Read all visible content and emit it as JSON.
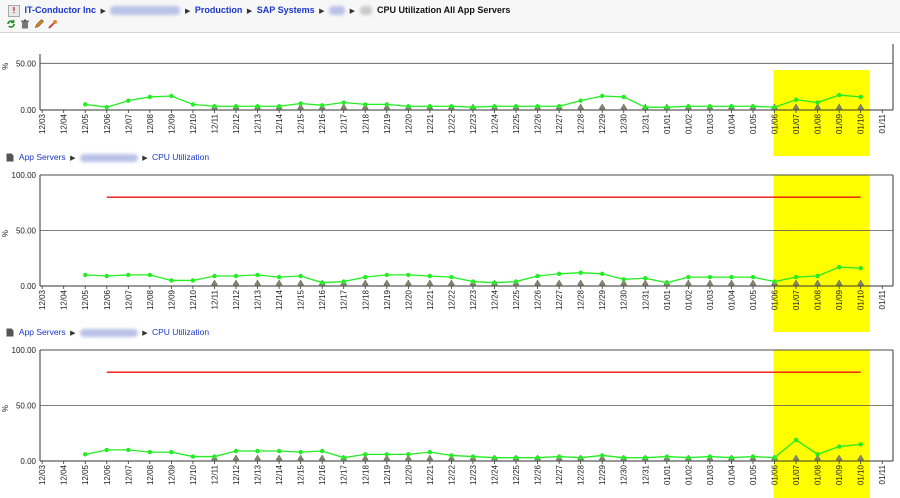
{
  "breadcrumb": {
    "root": "IT-Conductor Inc",
    "production": "Production",
    "sap_systems": "SAP Systems",
    "current": "CPU Utilization All App Servers"
  },
  "toolbar": {
    "refresh_icon": "refresh-icon",
    "delete_icon": "trash-icon",
    "edit_icon": "pencil-icon",
    "settings_icon": "tools-icon"
  },
  "sub_breadcrumb": {
    "app_servers": "App Servers",
    "cpu_utilization": "CPU Utilization"
  },
  "colors": {
    "series": "#22ee22",
    "threshold": "#ee1111",
    "highlight": "#ffff00",
    "link": "#1a36c9"
  },
  "chart_data": [
    {
      "type": "line",
      "x": [
        "12/03",
        "12/04",
        "12/05",
        "12/06",
        "12/07",
        "12/08",
        "12/09",
        "12/10",
        "12/11",
        "12/12",
        "12/13",
        "12/14",
        "12/15",
        "12/16",
        "12/17",
        "12/18",
        "12/19",
        "12/20",
        "12/21",
        "12/22",
        "12/23",
        "12/24",
        "12/25",
        "12/26",
        "12/27",
        "12/28",
        "12/29",
        "12/30",
        "12/31",
        "01/01",
        "01/02",
        "01/03",
        "01/04",
        "01/05",
        "01/06",
        "01/07",
        "01/08",
        "01/09",
        "01/10",
        "01/11"
      ],
      "ylabel": "%",
      "yticks": [
        "0.00",
        "50.00"
      ],
      "ylim": [
        0,
        60
      ],
      "series": [
        {
          "values": [
            null,
            null,
            6,
            3,
            10,
            14,
            15,
            6,
            4,
            4,
            4,
            4,
            7,
            5,
            8,
            6,
            6,
            4,
            4,
            4,
            3,
            4,
            4,
            4,
            4,
            10,
            15,
            14,
            3,
            3,
            4,
            4,
            4,
            4,
            3,
            11,
            8,
            16,
            14,
            null
          ]
        }
      ],
      "highlight_range": [
        "01/06",
        "01/10"
      ],
      "grid": true
    },
    {
      "type": "line",
      "x": [
        "12/03",
        "12/04",
        "12/05",
        "12/06",
        "12/07",
        "12/08",
        "12/09",
        "12/10",
        "12/11",
        "12/12",
        "12/13",
        "12/14",
        "12/15",
        "12/16",
        "12/17",
        "12/18",
        "12/19",
        "12/20",
        "12/21",
        "12/22",
        "12/23",
        "12/24",
        "12/25",
        "12/26",
        "12/27",
        "12/28",
        "12/29",
        "12/30",
        "12/31",
        "01/01",
        "01/02",
        "01/03",
        "01/04",
        "01/05",
        "01/06",
        "01/07",
        "01/08",
        "01/09",
        "01/10",
        "01/11"
      ],
      "ylabel": "%",
      "yticks": [
        "0.00",
        "50.00",
        "100.00"
      ],
      "ylim": [
        0,
        100
      ],
      "series": [
        {
          "values": [
            null,
            null,
            10,
            9,
            10,
            10,
            5,
            5,
            9,
            9,
            10,
            8,
            9,
            3,
            4,
            8,
            10,
            10,
            9,
            8,
            4,
            3,
            4,
            9,
            11,
            12,
            11,
            6,
            7,
            3,
            8,
            8,
            8,
            8,
            4,
            8,
            9,
            17,
            16,
            null
          ]
        }
      ],
      "threshold": {
        "value": 80,
        "from": "12/06",
        "to": "01/10"
      },
      "highlight_range": [
        "01/06",
        "01/10"
      ],
      "grid": true
    },
    {
      "type": "line",
      "x": [
        "12/03",
        "12/04",
        "12/05",
        "12/06",
        "12/07",
        "12/08",
        "12/09",
        "12/10",
        "12/11",
        "12/12",
        "12/13",
        "12/14",
        "12/15",
        "12/16",
        "12/17",
        "12/18",
        "12/19",
        "12/20",
        "12/21",
        "12/22",
        "12/23",
        "12/24",
        "12/25",
        "12/26",
        "12/27",
        "12/28",
        "12/29",
        "12/30",
        "12/31",
        "01/01",
        "01/02",
        "01/03",
        "01/04",
        "01/05",
        "01/06",
        "01/07",
        "01/08",
        "01/09",
        "01/10",
        "01/11"
      ],
      "ylabel": "%",
      "yticks": [
        "0.00",
        "50.00",
        "100.00"
      ],
      "ylim": [
        0,
        100
      ],
      "series": [
        {
          "values": [
            null,
            null,
            6,
            10,
            10,
            8,
            8,
            4,
            4,
            9,
            9,
            9,
            8,
            9,
            3,
            6,
            6,
            6,
            8,
            5,
            4,
            3,
            3,
            3,
            4,
            3,
            5,
            3,
            3,
            4,
            3,
            4,
            3,
            4,
            3,
            19,
            6,
            13,
            15,
            null
          ]
        }
      ],
      "threshold": {
        "value": 80,
        "from": "12/06",
        "to": "01/10"
      },
      "highlight_range": [
        "01/06",
        "01/10"
      ],
      "grid": true
    }
  ]
}
